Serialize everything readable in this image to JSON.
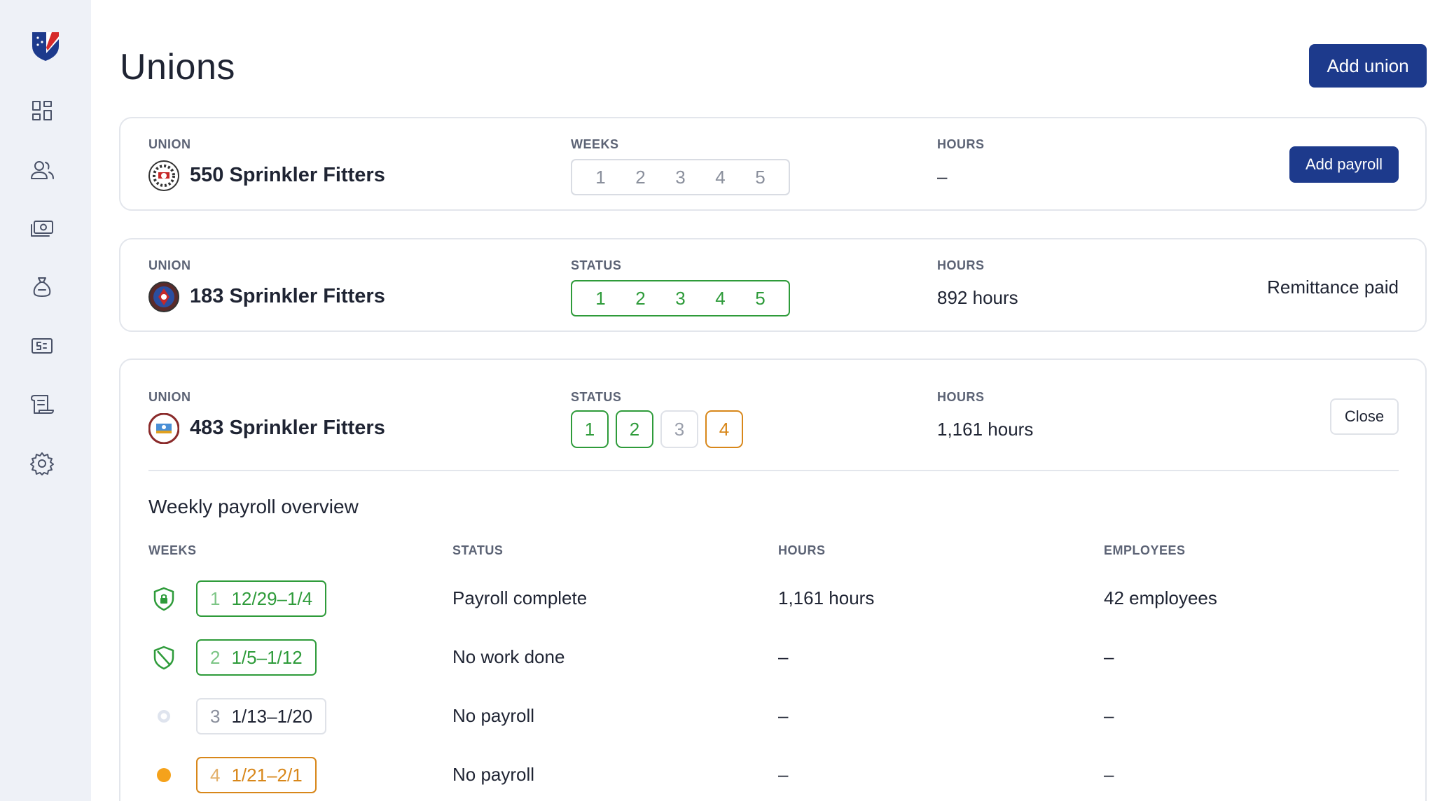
{
  "page": {
    "title": "Unions",
    "add_union_label": "Add union"
  },
  "sidebar": {
    "items": [
      {
        "icon": "dashboard-icon"
      },
      {
        "icon": "people-icon"
      },
      {
        "icon": "money-icon"
      },
      {
        "icon": "money-bag-icon"
      },
      {
        "icon": "dollar-card-icon"
      },
      {
        "icon": "scroll-icon"
      },
      {
        "icon": "gear-icon"
      }
    ]
  },
  "colors": {
    "primary": "#1d3a8c",
    "green": "#2e9b3a",
    "orange": "#d8871a",
    "sidebar_bg": "#eef1f7"
  },
  "unions": [
    {
      "union_label": "UNION",
      "name": "550 Sprinkler Fitters",
      "weeks_label": "WEEKS",
      "weeks": [
        "1",
        "2",
        "3",
        "4",
        "5"
      ],
      "hours_label": "HOURS",
      "hours": "–",
      "action_label": "Add payroll"
    },
    {
      "union_label": "UNION",
      "name": "183 Sprinkler Fitters",
      "weeks_label": "STATUS",
      "weeks": [
        "1",
        "2",
        "3",
        "4",
        "5"
      ],
      "hours_label": "HOURS",
      "hours": "892 hours",
      "status": "Remittance paid"
    },
    {
      "union_label": "UNION",
      "name": "483 Sprinkler Fitters",
      "weeks_label": "STATUS",
      "weeks": [
        {
          "n": "1",
          "state": "complete"
        },
        {
          "n": "2",
          "state": "complete"
        },
        {
          "n": "3",
          "state": "none"
        },
        {
          "n": "4",
          "state": "pending"
        }
      ],
      "hours_label": "HOURS",
      "hours": "1,161 hours",
      "close_label": "Close",
      "overview": {
        "title": "Weekly payroll overview",
        "headers": {
          "weeks": "WEEKS",
          "status": "STATUS",
          "hours": "HOURS",
          "employees": "EMPLOYEES"
        },
        "rows": [
          {
            "num": "1",
            "range": "12/29–1/4",
            "status": "Payroll complete",
            "hours": "1,161 hours",
            "employees": "42 employees",
            "icon": "shield-lock-icon",
            "state": "complete"
          },
          {
            "num": "2",
            "range": "1/5–1/12",
            "status": "No work done",
            "hours": "–",
            "employees": "–",
            "icon": "shield-slash-icon",
            "state": "complete"
          },
          {
            "num": "3",
            "range": "1/13–1/20",
            "status": "No payroll",
            "hours": "–",
            "employees": "–",
            "icon": "empty-dot-icon",
            "state": "none"
          },
          {
            "num": "4",
            "range": "1/21–2/1",
            "status": "No payroll",
            "hours": "–",
            "employees": "–",
            "icon": "orange-dot-icon",
            "state": "pending"
          }
        ]
      }
    }
  ]
}
